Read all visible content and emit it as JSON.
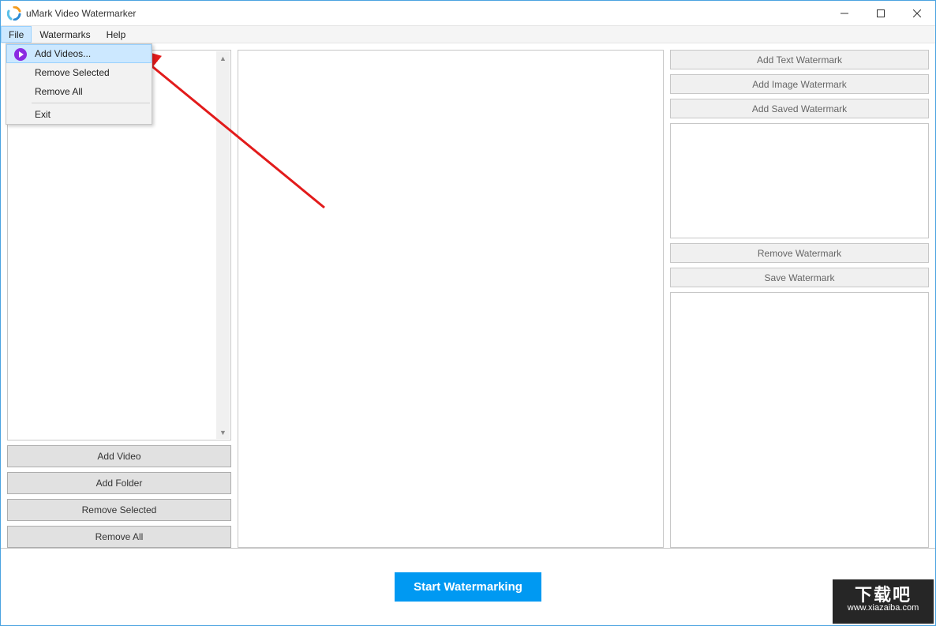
{
  "titlebar": {
    "app_title": "uMark Video Watermarker"
  },
  "menubar": {
    "file": "File",
    "watermarks": "Watermarks",
    "help": "Help"
  },
  "file_menu": {
    "add_videos": "Add Videos...",
    "remove_selected": "Remove Selected",
    "remove_all": "Remove All",
    "exit": "Exit"
  },
  "left": {
    "add_video": "Add Video",
    "add_folder": "Add Folder",
    "remove_selected": "Remove Selected",
    "remove_all": "Remove All"
  },
  "right": {
    "add_text": "Add Text Watermark",
    "add_image": "Add Image Watermark",
    "add_saved": "Add Saved Watermark",
    "remove_wm": "Remove Watermark",
    "save_wm": "Save Watermark"
  },
  "footer": {
    "start": "Start Watermarking"
  },
  "corner": {
    "url": "www.xiazaiba.com",
    "text": "下载吧"
  }
}
